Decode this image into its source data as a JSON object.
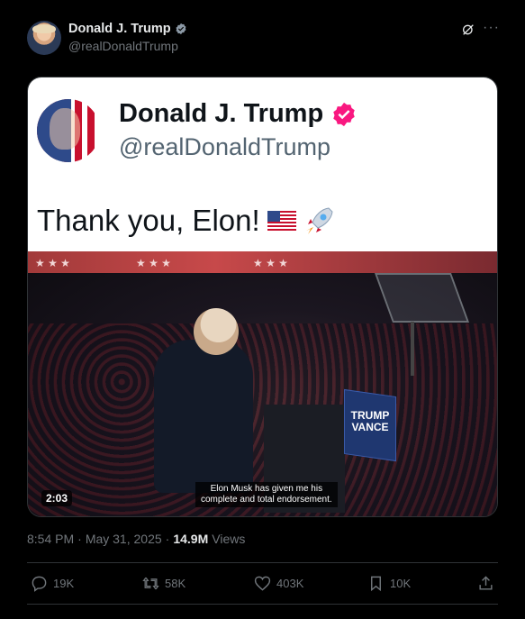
{
  "author": {
    "name": "Donald J. Trump",
    "handle": "@realDonaldTrump"
  },
  "icons": {
    "verified": "verified-badge-icon",
    "grok": "grok-icon",
    "more": "more-icon",
    "reply": "reply-icon",
    "repost": "repost-icon",
    "like": "like-icon",
    "bookmark": "bookmark-icon",
    "share": "share-icon"
  },
  "media": {
    "card": {
      "name": "Donald J. Trump",
      "handle": "@realDonaldTrump",
      "text": "Thank you, Elon!"
    },
    "sign": {
      "line1": "TRUMP",
      "line2": "VANCE"
    },
    "subtitle_line1": "Elon Musk has given me his",
    "subtitle_line2": "complete and total endorsement.",
    "duration": "2:03"
  },
  "meta": {
    "time": "8:54 PM",
    "separator": "·",
    "date": "May 31, 2025",
    "views_count": "14.9M",
    "views_label": "Views"
  },
  "actions": {
    "replies": "19K",
    "reposts": "58K",
    "likes": "403K",
    "bookmarks": "10K"
  },
  "colors": {
    "background": "#000000",
    "text_primary": "#e7e9ea",
    "text_secondary": "#71767b",
    "verified_blue": "#1d9bf0",
    "verified_pink": "#f91880"
  }
}
